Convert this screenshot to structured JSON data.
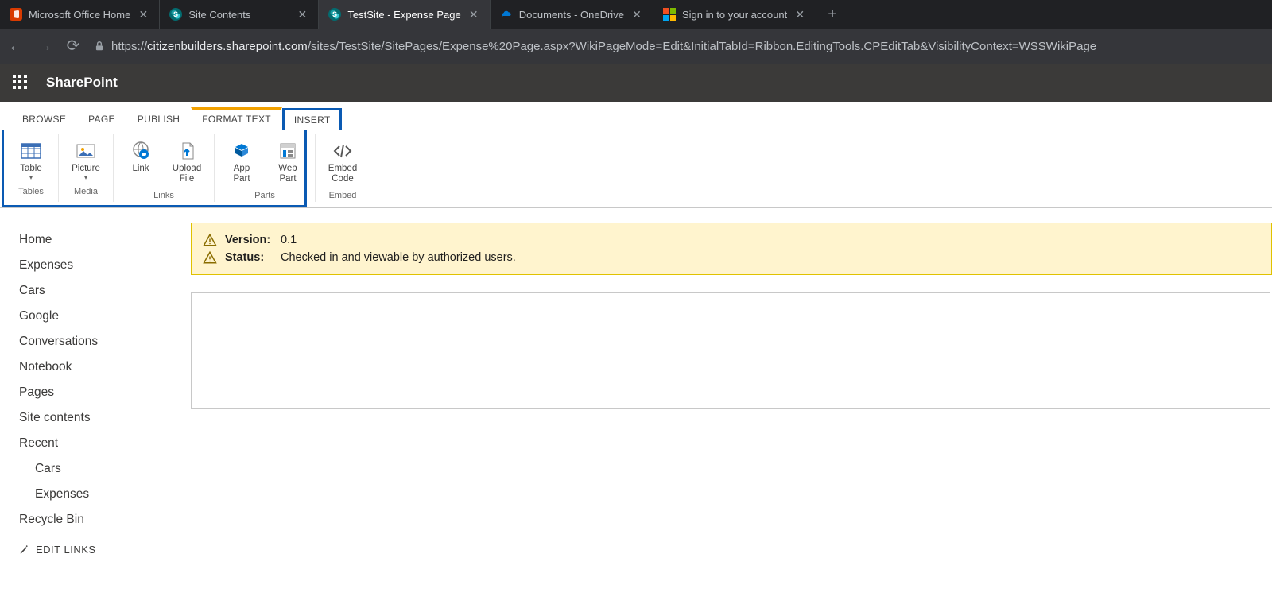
{
  "browser": {
    "tabs": [
      {
        "title": "Microsoft Office Home",
        "icon": "office"
      },
      {
        "title": "Site Contents",
        "icon": "sp"
      },
      {
        "title": "TestSite - Expense Page",
        "icon": "sp",
        "active": true
      },
      {
        "title": "Documents - OneDrive",
        "icon": "onedrive"
      },
      {
        "title": "Sign in to your account",
        "icon": "ms"
      }
    ],
    "url_prefix": "https://",
    "url_domain": "citizenbuilders.sharepoint.com",
    "url_path": "/sites/TestSite/SitePages/Expense%20Page.aspx?WikiPageMode=Edit&InitialTabId=Ribbon.EditingTools.CPEditTab&VisibilityContext=WSSWikiPage"
  },
  "suite": {
    "title": "SharePoint"
  },
  "ribbon": {
    "tabs": [
      "BROWSE",
      "PAGE",
      "PUBLISH",
      "FORMAT TEXT",
      "INSERT"
    ],
    "active": "INSERT",
    "contextual": [
      "FORMAT TEXT",
      "INSERT"
    ],
    "groups": [
      {
        "label": "Tables",
        "items": [
          {
            "label": "Table",
            "dropdown": true,
            "icon": "table"
          }
        ]
      },
      {
        "label": "Media",
        "items": [
          {
            "label": "Picture",
            "dropdown": true,
            "icon": "picture"
          }
        ]
      },
      {
        "label": "Links",
        "items": [
          {
            "label": "Link",
            "icon": "link"
          },
          {
            "label": "Upload\nFile",
            "icon": "upload"
          }
        ]
      },
      {
        "label": "Parts",
        "items": [
          {
            "label": "App\nPart",
            "icon": "apppart"
          },
          {
            "label": "Web\nPart",
            "icon": "webpart"
          }
        ]
      },
      {
        "label": "Embed",
        "items": [
          {
            "label": "Embed\nCode",
            "icon": "embed"
          }
        ]
      }
    ]
  },
  "leftnav": {
    "items": [
      {
        "label": "Home"
      },
      {
        "label": "Expenses"
      },
      {
        "label": "Cars"
      },
      {
        "label": "Google"
      },
      {
        "label": "Conversations"
      },
      {
        "label": "Notebook"
      },
      {
        "label": "Pages"
      },
      {
        "label": "Site contents"
      },
      {
        "label": "Recent"
      },
      {
        "label": "Cars",
        "sub": true
      },
      {
        "label": "Expenses",
        "sub": true
      },
      {
        "label": "Recycle Bin"
      }
    ],
    "edit": "EDIT LINKS"
  },
  "status": {
    "lines": [
      {
        "key": "Version:",
        "val": "0.1"
      },
      {
        "key": "Status:",
        "val": "Checked in and viewable by authorized users."
      }
    ]
  }
}
